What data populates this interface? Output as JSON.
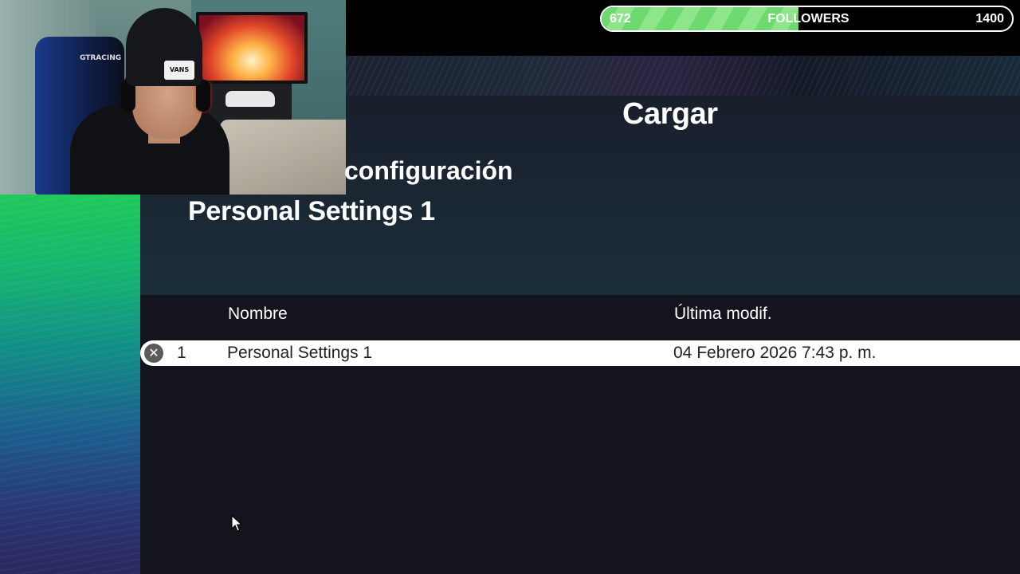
{
  "followers": {
    "current": "672",
    "label": "FOLLOWERS",
    "goal": "1400",
    "progress_fraction": 0.48,
    "fill_color": "#6ed96f"
  },
  "dialog": {
    "title": "Cargar",
    "config_label": "configuración",
    "config_name": "Personal Settings 1"
  },
  "table": {
    "headers": {
      "name": "Nombre",
      "modified": "Última modif."
    },
    "rows": [
      {
        "index": "1",
        "name": "Personal Settings 1",
        "modified": "04 Febrero 2026 7:43 p. m.",
        "delete_icon": "close-circle-icon"
      }
    ]
  },
  "webcam": {
    "beanie_text": "VANS",
    "chair_text": "GTRACING"
  },
  "colors": {
    "accent_green": "#20c85a",
    "background": "#13141d",
    "row_highlight": "#ffffff"
  }
}
